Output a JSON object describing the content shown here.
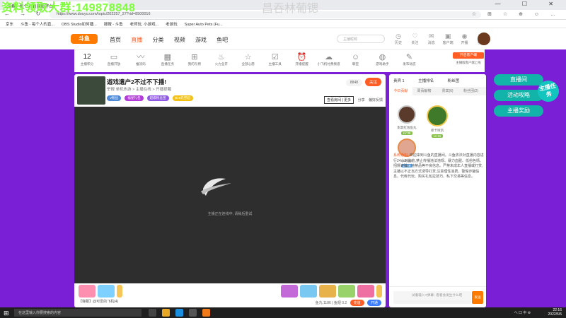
{
  "overlay": {
    "qq_text": "资料领取大群:149878848",
    "room_text": "昌吞林葡锶"
  },
  "browser": {
    "tab_title": "斗鱼 - 每个人的直播平台",
    "window_controls": "— ☐ ✕",
    "nav_glyphs": "← → ↻",
    "url": "https://www.douyu.com/topic/202257_27?rid=8500016",
    "tools_glyphs": "☆ ⊞ ☆ ⊕ ☺ …",
    "bookmarks": [
      "京东",
      "斗鱼 - 每个人的直...",
      "OBS Studio如何播...",
      "搜搜 - 斗鱼",
      "老师玩, 小游戏...",
      "老游玩",
      "Super Auto Pets (Fu..."
    ]
  },
  "site": {
    "logo": "斗鱼",
    "nav": [
      "首页",
      "直播",
      "分类",
      "视频",
      "游戏",
      "鱼吧"
    ],
    "active_nav": "直播",
    "search_placeholder": "主播昵称",
    "header_icons": [
      {
        "icon": "history-icon",
        "label": "历史"
      },
      {
        "icon": "follow-icon",
        "label": "关注"
      },
      {
        "icon": "message-icon",
        "label": "消息"
      },
      {
        "icon": "client-icon",
        "label": "客户端"
      },
      {
        "icon": "live-icon",
        "label": "开播"
      },
      {
        "icon": "video-icon",
        "label": "视频"
      }
    ]
  },
  "toolbar": {
    "count": "12",
    "count_label": "主播积分",
    "items": [
      {
        "icon": "level-icon",
        "label": "直播开放"
      },
      {
        "icon": "audio-icon",
        "label": "推流码"
      },
      {
        "icon": "task-icon",
        "label": "直播任务"
      },
      {
        "icon": "gift-icon",
        "label": "我的礼物"
      },
      {
        "icon": "fire-icon",
        "label": "火力全开"
      },
      {
        "icon": "wish-icon",
        "label": "全部心愿"
      },
      {
        "icon": "box-icon",
        "label": "主播工具"
      },
      {
        "icon": "clock-icon",
        "label": "开播提醒"
      },
      {
        "icon": "cloud-icon",
        "label": "小飞机付费频道"
      },
      {
        "icon": "chat-icon",
        "label": "聊室"
      },
      {
        "icon": "game-icon",
        "label": "游戏助手"
      },
      {
        "icon": "edit-icon",
        "label": "发布动态"
      }
    ],
    "right_button": "开启客户端",
    "right_text": "主播版客户端上线"
  },
  "room": {
    "title": "遊戏遺产2不过不下播!",
    "meta": "举报   单机热游 > 主播在线 > 开播提醒",
    "badges": [
      {
        "text": "V粉丝",
        "color": "#4f8ad8"
      },
      {
        "text": "福星礼包",
        "color": "#b13ad9"
      },
      {
        "text": "超级粉丝团",
        "color": "#8f57e6"
      },
      {
        "text": "$18元券起",
        "color": "#f4c112"
      }
    ],
    "hot": "8848",
    "follow": "关注",
    "action_box": "查看房间 | 更多",
    "share": "分享",
    "report": "偏好反馈",
    "video_status": "主播正在连线中, 请稍后重试",
    "chat_text": "【弹幕】@可爱的飞机(4)",
    "coins": "鱼丸 1186  |  鱼翅 0.2",
    "recharge": "充值",
    "recharge2": "开通"
  },
  "sidebar": {
    "top_left": "贵宾 1",
    "top_mid": "主播排名",
    "top_right": "粉丝团",
    "tabs": [
      "今日贡献",
      "周贡献榜",
      "贵宾(6)",
      "粉丝团(2)"
    ],
    "active_tab": "今日贡献",
    "ranks": [
      {
        "name": "影歌红烛鱼丸",
        "level": "LV 38"
      },
      {
        "name": "拒卡咩凯",
        "level": "LV 31"
      },
      {
        "name": "21bel88",
        "level": "LV 16"
      }
    ],
    "notice_label": "系统通知:",
    "notice": "欢迎来到斗鱼的直播间。斗鱼依法对直播内容进行24小时监管,禁止传播违法违规、暴力血腥、低俗色情、招嫖诈骗、违禁品等不良信息。严禁未成年人直播或打赏,主播以不正当方式诱导打赏,注意理性消费。警惕诈骗信息。代练代玩、购买礼包拉技巧、私下交易等信息。",
    "input_placeholder": "试着输入'#弹幕', 看看会发生什么吧",
    "send": "发送"
  },
  "right_buttons": [
    "直播间",
    "活动攻略",
    "主播奖励"
  ],
  "task_badge": "主播任务",
  "taskbar": {
    "search": "在这里输入你要搜索的内容",
    "time": "22:16",
    "date": "2022/5/5",
    "tray": "ヘ 口 中 ⊕ "
  }
}
